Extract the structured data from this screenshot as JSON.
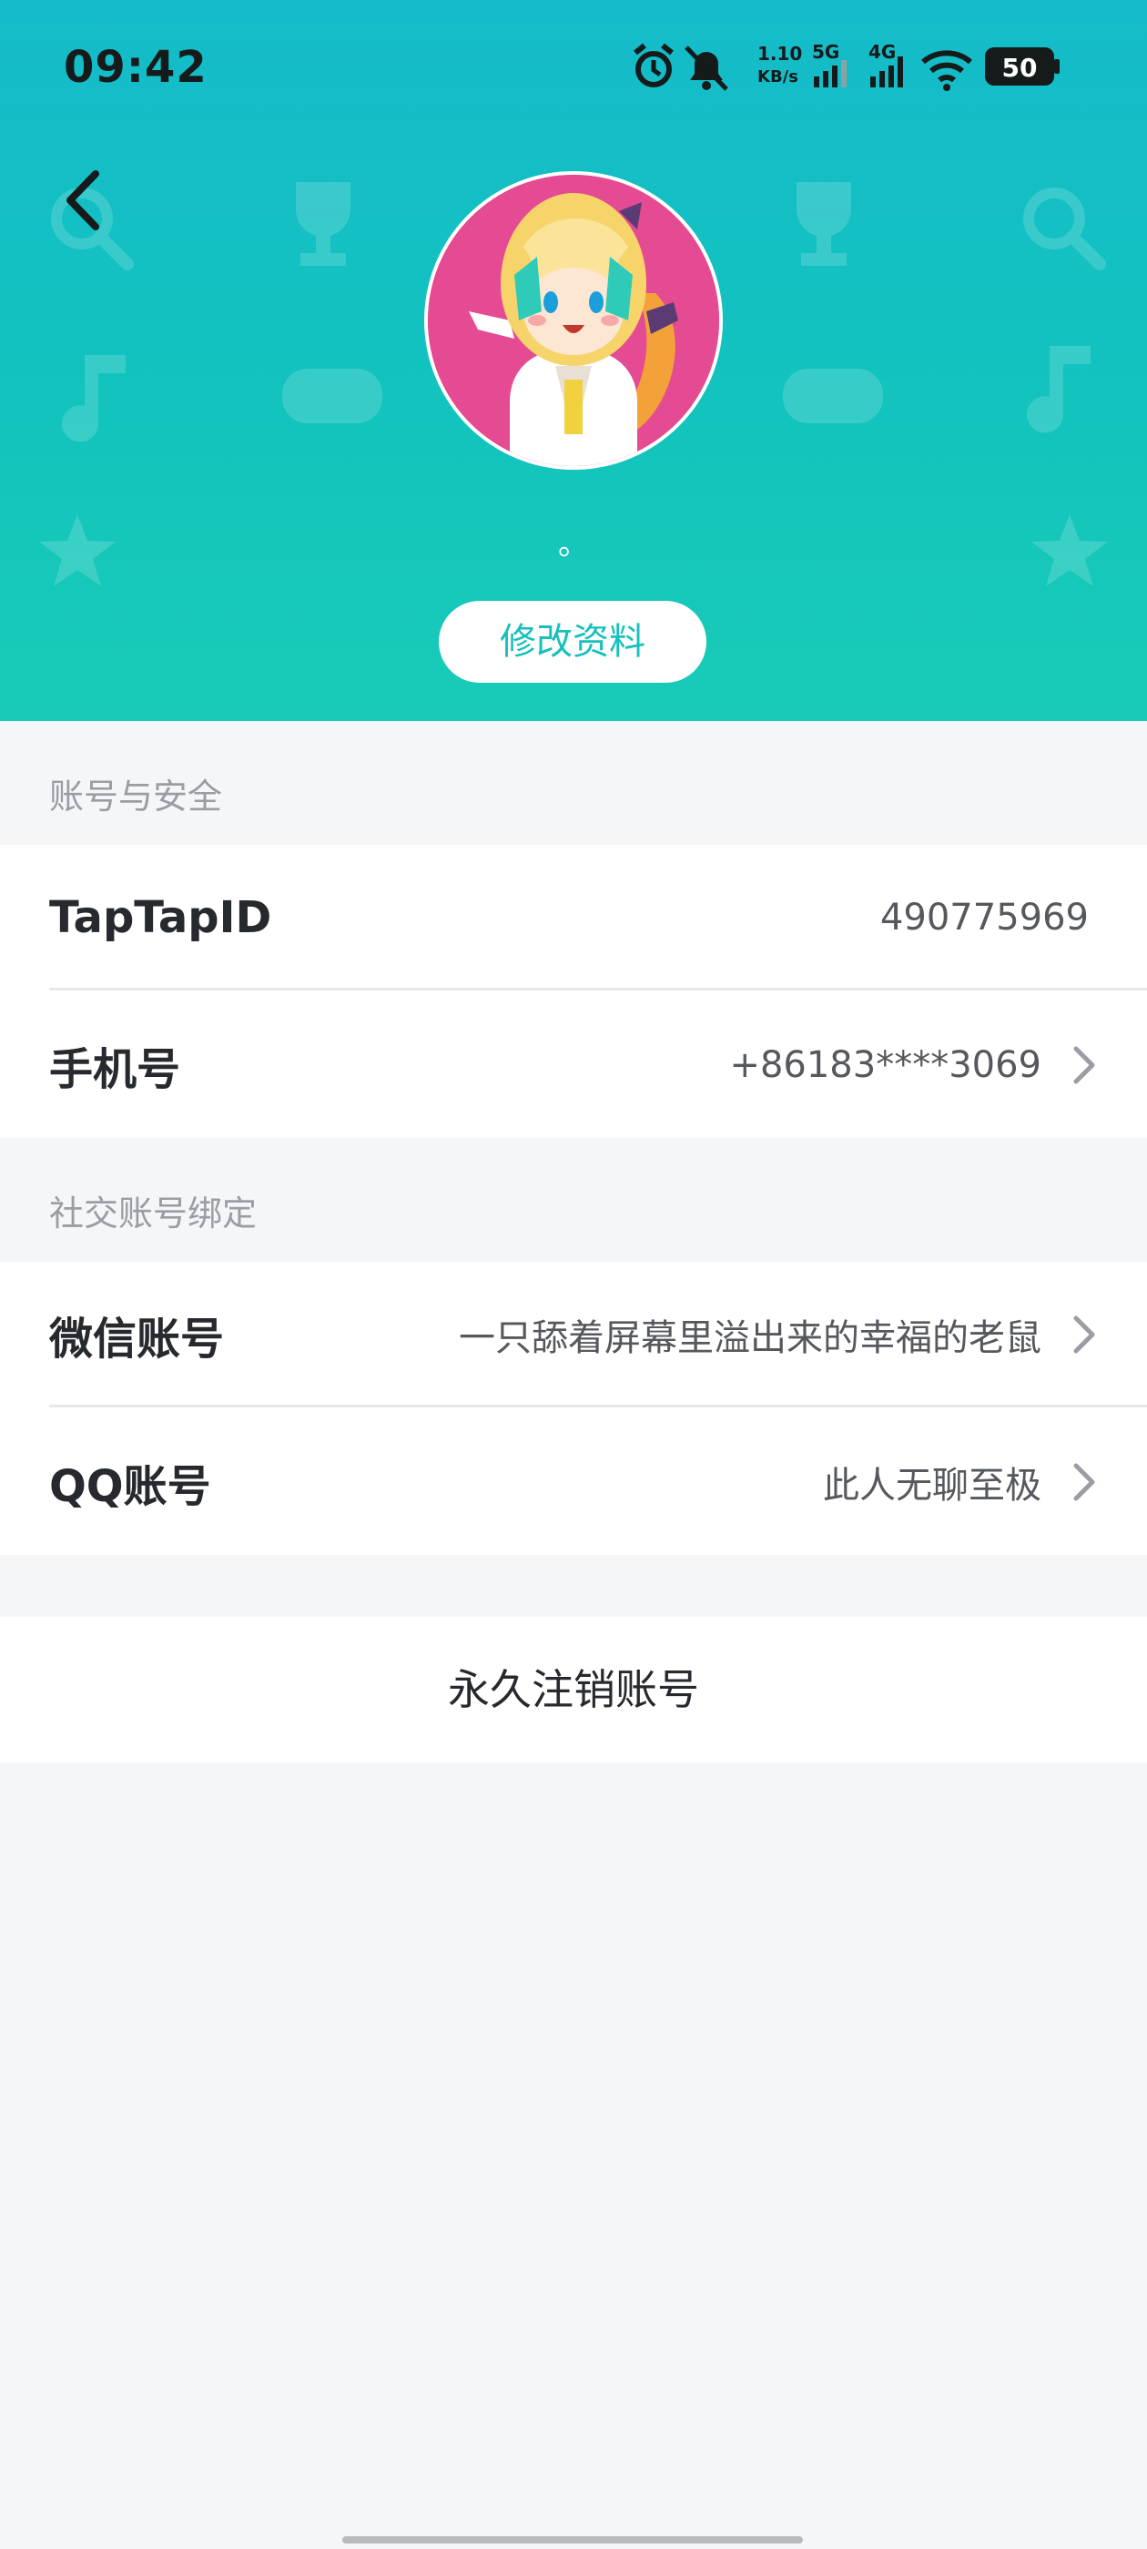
{
  "status_bar": {
    "time": "09:42",
    "network_speed": "1.10",
    "network_speed_unit": "KB/s",
    "sim1": "5G",
    "sim2": "4G",
    "battery": "50",
    "icons": [
      "alarm-icon",
      "bell-muted-icon",
      "signal-icon",
      "wifi-icon",
      "battery-icon"
    ]
  },
  "header": {
    "back_icon": "chevron-left-icon",
    "nickname": "。",
    "edit_profile_label": "修改资料",
    "colors": {
      "gradient_top": "#15bbca",
      "gradient_bottom": "#19cbb7",
      "accent": "#16c1bc"
    }
  },
  "account_security": {
    "title": "账号与安全",
    "rows": [
      {
        "label": "TapTapID",
        "value": "490775969",
        "has_arrow": false
      },
      {
        "label": "手机号",
        "value": "+86183****3069",
        "has_arrow": true
      }
    ]
  },
  "social_binding": {
    "title": "社交账号绑定",
    "rows": [
      {
        "label": "微信账号",
        "value": "一只舔着屏幕里溢出来的幸福的老鼠",
        "has_arrow": true
      },
      {
        "label": "QQ账号",
        "value": "此人无聊至极",
        "has_arrow": true
      }
    ]
  },
  "delete_account_label": "永久注销账号"
}
